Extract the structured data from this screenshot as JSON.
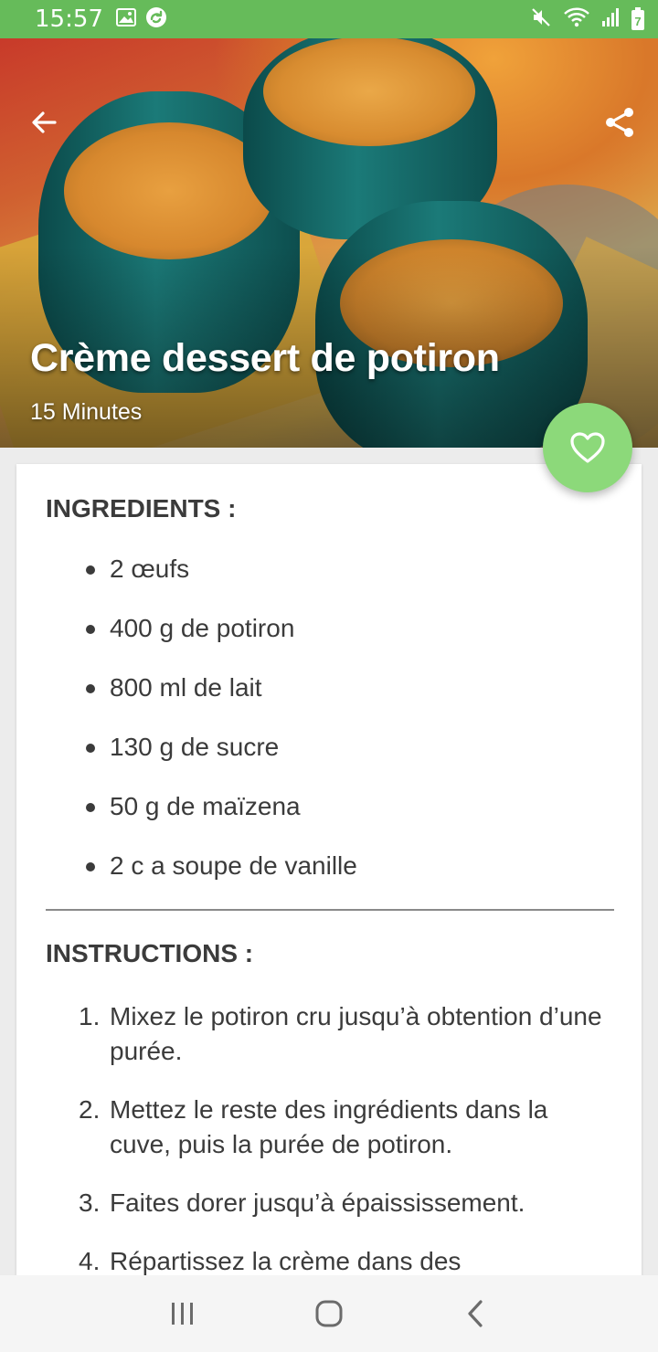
{
  "status_bar": {
    "time": "15:57",
    "left_icons": [
      "gallery-icon",
      "sync-app-icon"
    ],
    "right_icons": [
      "mute-icon",
      "wifi-icon",
      "signal-icon",
      "battery-icon"
    ],
    "battery_level": "7"
  },
  "header": {
    "back_icon": "arrow-left-icon",
    "share_icon": "share-icon"
  },
  "recipe": {
    "title": "Crème dessert de potiron",
    "duration": "15 Minutes",
    "favorite_icon": "heart-outline-icon"
  },
  "ingredients": {
    "heading": "INGREDIENTS :",
    "items": [
      "2 œufs",
      "400 g de potiron",
      "800 ml de lait",
      "130 g de sucre",
      "50 g de maïzena",
      "2 c a soupe de vanille"
    ]
  },
  "instructions": {
    "heading": "INSTRUCTIONS :",
    "steps": [
      {
        "num": "1.",
        "text": "Mixez le potiron cru jusqu’à obtention d’une purée."
      },
      {
        "num": "2.",
        "text": "Mettez le reste des ingrédients dans la cuve, puis la purée de potiron."
      },
      {
        "num": "3.",
        "text": "Faites dorer jusqu’à épaississement."
      },
      {
        "num": "4.",
        "text": "Répartissez la crème dans des"
      }
    ]
  },
  "colors": {
    "status_bar": "#66bb5a",
    "fab": "#8cd97a",
    "text": "#3b3b3b"
  },
  "nav_bar": {
    "icons": [
      "recent-apps-icon",
      "home-icon",
      "back-icon"
    ]
  }
}
